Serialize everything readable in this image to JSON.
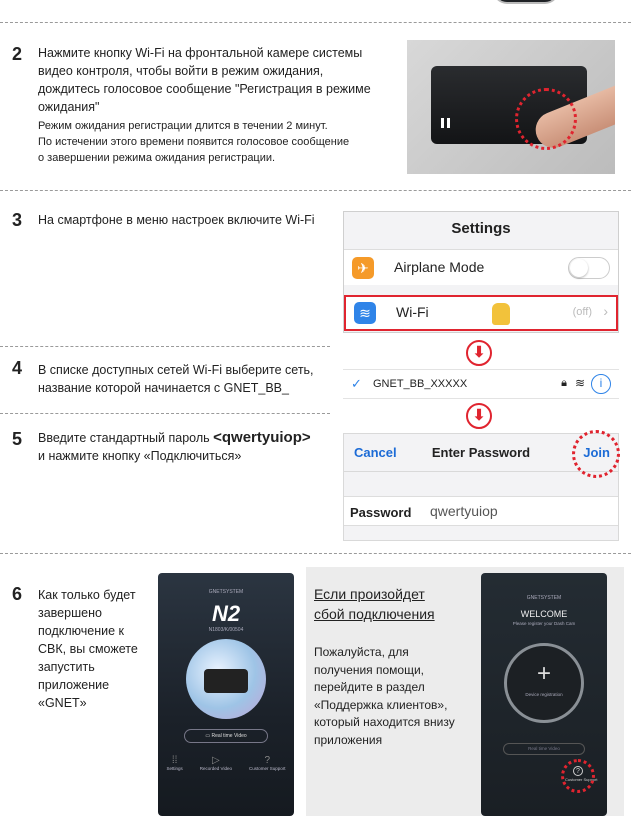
{
  "steps": {
    "s2": {
      "num": "2",
      "lines": [
        "Нажмите кнопку Wi-Fi на фронтальной камере системы",
        "видео контроля, чтобы войти в режим ожидания,",
        "дождитесь голосовое сообщение \"Регистрация в режиме",
        "ожидания\""
      ],
      "note": [
        "Режим ожидания регистрации длится в течении 2 минут.",
        "По истечении этого времени появится голосовое сообщение",
        "о завершении режима ожидания регистрации."
      ]
    },
    "s3": {
      "num": "3",
      "text": "На смартфоне в меню настроек включите Wi-Fi"
    },
    "s4": {
      "num": "4",
      "lines": [
        "В списке доступных сетей Wi-Fi выберите сеть,",
        "название которой начинается с GNET_BB_"
      ]
    },
    "s5": {
      "num": "5",
      "line1_prefix": "Введите стандартный пароль",
      "password_tag": "<qwertyuiop>",
      "line2": "и нажмите кнопку «Подключиться»"
    },
    "s6": {
      "num": "6",
      "lines": [
        "Как только будет",
        "завершено",
        "подключение к",
        "СВК, вы сможете",
        "запустить",
        "приложение",
        "«GNET»"
      ]
    }
  },
  "settings_screen": {
    "title": "Settings",
    "airplane": "Airplane Mode",
    "wifi": "Wi-Fi",
    "wifi_value": "(off)",
    "accent": "#e0242f"
  },
  "network": {
    "ssid": "GNET_BB_XXXXX"
  },
  "password_screen": {
    "cancel": "Cancel",
    "title": "Enter Password",
    "join": "Join",
    "label": "Password",
    "value": "qwertyuiop"
  },
  "phone1": {
    "brand": "GNETSYSTEM",
    "model": "N2",
    "serial": "N1803/K/00504",
    "live_btn": "Real time Video",
    "tabs": [
      "Settings",
      "Recorded Video",
      "Customer Support"
    ]
  },
  "failure_box": {
    "title_lines": [
      "Если произойдет",
      "сбой подключения"
    ],
    "body_lines": [
      "Пожалуйста, для",
      "получения помощи,",
      "перейдите в раздел",
      "«Поддержка клиентов»,",
      "который находится внизу",
      "приложения"
    ]
  },
  "phone2": {
    "brand": "GNETSYSTEM",
    "welcome": "WELCOME",
    "subtitle": "Please register your Dash Cam",
    "register": "Device registration",
    "live_btn": "Real time Video",
    "support": "Customer Support"
  }
}
